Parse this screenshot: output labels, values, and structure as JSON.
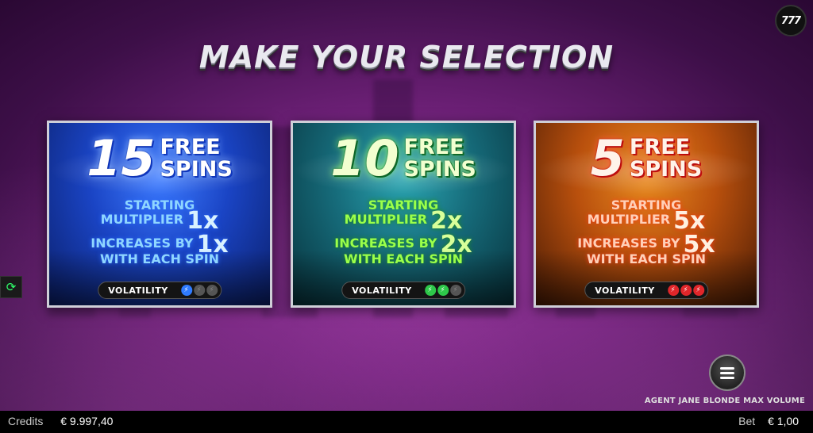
{
  "title": "MAKE YOUR SELECTION",
  "logo": "777",
  "options": [
    {
      "spins": "15",
      "free": "FREE",
      "spins_word": "SPINS",
      "starting": "STARTING",
      "multiplier": "MULTIPLIER",
      "start_value": "1x",
      "increases": "INCREASES BY",
      "increase_value": "1x",
      "with_each": "WITH EACH SPIN",
      "volatility_label": "VOLATILITY",
      "volatility_level": 1,
      "color": "#2f7bff"
    },
    {
      "spins": "10",
      "free": "FREE",
      "spins_word": "SPINS",
      "starting": "STARTING",
      "multiplier": "MULTIPLIER",
      "start_value": "2x",
      "increases": "INCREASES BY",
      "increase_value": "2x",
      "with_each": "WITH EACH SPIN",
      "volatility_label": "VOLATILITY",
      "volatility_level": 2,
      "color": "#2ec84a"
    },
    {
      "spins": "5",
      "free": "FREE",
      "spins_word": "SPINS",
      "starting": "STARTING",
      "multiplier": "MULTIPLIER",
      "start_value": "5x",
      "increases": "INCREASES BY",
      "increase_value": "5x",
      "with_each": "WITH EACH SPIN",
      "volatility_label": "VOLATILITY",
      "volatility_level": 3,
      "color": "#e0262a"
    }
  ],
  "game_name": "AGENT JANE BLONDE MAX VOLUME",
  "footer": {
    "credits_label": "Credits",
    "credits_value": "€ 9.997,40",
    "bet_label": "Bet",
    "bet_value": "€ 1,00"
  },
  "icons": {
    "autoplay": "refresh-icon",
    "menu": "hamburger-icon",
    "volatility": "lightning-bolt-icon"
  }
}
